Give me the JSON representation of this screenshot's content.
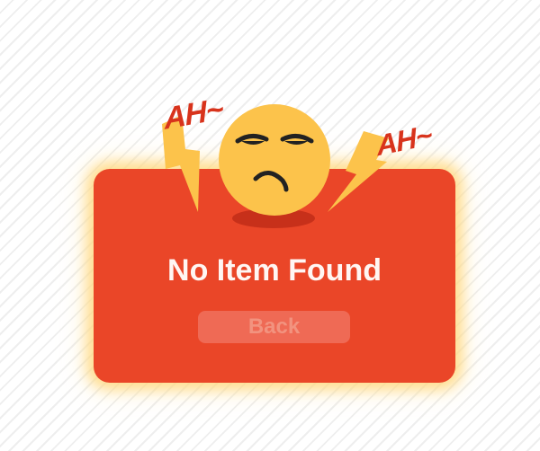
{
  "dialog": {
    "title": "No Item Found",
    "back_label": "Back",
    "exclaim_left": "AH~",
    "exclaim_right": "AH~"
  },
  "icons": {
    "face": "annoyed-face-icon",
    "bolt": "lightning-bolt-icon"
  },
  "colors": {
    "card": "#ea4628",
    "face": "#fcc34b",
    "bolt": "#fcc34b",
    "exclaim": "#d8331c",
    "button_bg": "#ef6a55",
    "button_text": "#f2937f",
    "glow": "#ffd678"
  }
}
